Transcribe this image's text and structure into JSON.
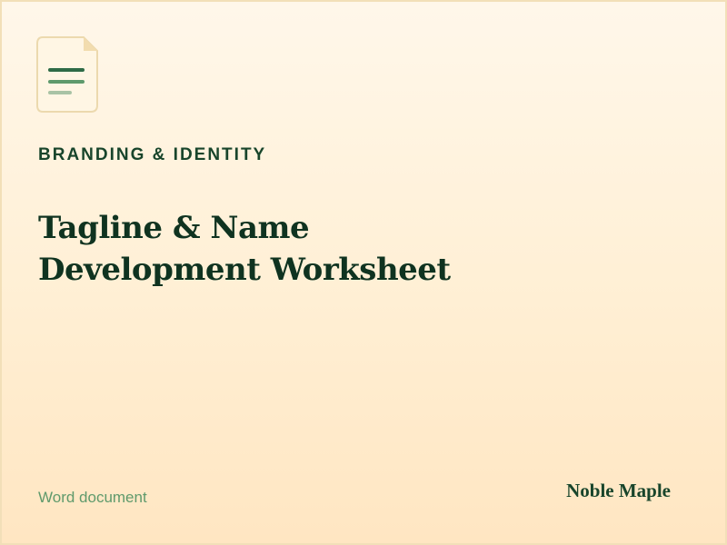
{
  "icon": {
    "name": "document-icon"
  },
  "category": "BRANDING & IDENTITY",
  "title": {
    "line1": "Tagline & Name",
    "line2": "Development Worksheet"
  },
  "document_type": "Word document",
  "brand": "Noble Maple",
  "colors": {
    "background_top": "#fff7ea",
    "background_bottom": "#ffe6c2",
    "border": "#f2dfb8",
    "heading": "#0f3320",
    "accent_green": "#2f6b46",
    "muted_green": "#5f9a6c",
    "fold": "#f2dcae"
  }
}
